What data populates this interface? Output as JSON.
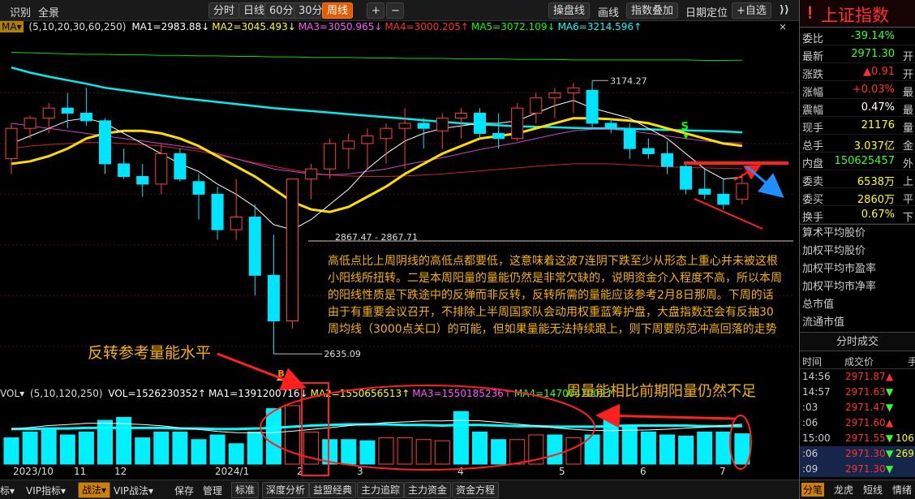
{
  "toolbar": {
    "left": [
      "识别",
      "全景"
    ],
    "periods": [
      "分时",
      "日线",
      "60分",
      "30分",
      "周线"
    ],
    "active_period": "周线",
    "plus": "+",
    "minus": "−",
    "right": [
      "操盘线",
      "画线",
      "指数叠加",
      "日期定位",
      "+自选"
    ]
  },
  "ma_row": {
    "selector": "MA▾",
    "params": "(5,10,20,30,60,250)",
    "items": [
      {
        "text": "MA1=2983.88↓",
        "color": "#ffffff"
      },
      {
        "text": "MA2=3045.493↓",
        "color": "#ffff00"
      },
      {
        "text": "MA3=3050.965↓",
        "color": "#ff55ff"
      },
      {
        "text": "MA4=3000.205↑",
        "color": "#ff3030"
      },
      {
        "text": "MA5=3072.109↓",
        "color": "#00ff00"
      },
      {
        "text": "MA6=3214.596↑",
        "color": "#00ffff"
      }
    ]
  },
  "price_labels": {
    "high": "3174.27",
    "mid": "2867.47 - 2867.71",
    "low": "2635.09"
  },
  "markers": {
    "buy": "B",
    "sell": "S"
  },
  "annotation": "高低点比上周阴线的高低点都要低，这意味着这波7连阴下跌至少从形态上重心并未被这根小阳线所扭转。二是本周阳量的量能仍然是非常欠缺的，说明资金介入程度不高，所以本周的阳线性质是下跌途中的反弹而非反转，反转所需的量能应该参考2月8日那周。下周的话由于有重要会议召开，不排除上半周国家队会动用权重蓝筹护盘，大盘指数还会有反抽30周均线（3000点关口）的可能，但如果量能无法持续跟上，则下周要防范冲高回落的走势",
  "annotation_reversal": "反转参考量能水平",
  "annotation_volume": "周量能相比前期阳量仍然不足",
  "vol_row": {
    "selector": "VOL▾",
    "params": "(5,10,120,250)",
    "items": [
      {
        "text": "VOL=1526230352↑",
        "color": "#ffffff"
      },
      {
        "text": "MA1=1391200716↓",
        "color": "#ffffff"
      },
      {
        "text": "MA2=1550656513↑",
        "color": "#ffff00"
      },
      {
        "text": "MA3=1550185236↑",
        "color": "#ff55ff"
      },
      {
        "text": "MA4=1470047002↑",
        "color": "#33ff33"
      }
    ]
  },
  "x_axis": [
    "2023/10",
    "11",
    "12",
    "2024/1",
    "2",
    "3",
    "4",
    "5",
    "6",
    "7"
  ],
  "bottom_bar": [
    "标▾",
    "VIP指标▾",
    "战法▾",
    "VIP战法▾",
    "保存",
    "管理",
    "标准",
    "深度分析",
    "益盟经典",
    "主力追踪",
    "主力资金",
    "资金方程"
  ],
  "bottom_active": "战法▾",
  "right_panel": {
    "title": "上证指数",
    "rows": [
      {
        "label": "委比",
        "value": "-39.14%",
        "color": "#33ff33",
        "suffix": ""
      },
      {
        "label": "最新",
        "value": "2971.30",
        "color": "#33ff33",
        "suffix": "开"
      },
      {
        "label": "涨跌",
        "value": "▲0.91",
        "color": "#ff3030",
        "suffix": "开"
      },
      {
        "label": "涨幅",
        "value": "+0.03%",
        "color": "#ff3030",
        "suffix": "最"
      },
      {
        "label": "震幅",
        "value": "0.47%",
        "color": "#ffffff",
        "suffix": "最"
      },
      {
        "label": "现手",
        "value": "21176",
        "color": "#ffff00",
        "suffix": "量"
      },
      {
        "label": "总手",
        "value": "3.037亿",
        "color": "#ffff00",
        "suffix": "金"
      },
      {
        "label": "内盘",
        "value": "150625457",
        "color": "#33ff33",
        "suffix": "外"
      },
      {
        "label": "委卖",
        "value": "6538万",
        "color": "#ffff00",
        "suffix": "上"
      },
      {
        "label": "委买",
        "value": "2860万",
        "color": "#ffff00",
        "suffix": "平"
      },
      {
        "label": "换手",
        "value": "0.67%",
        "color": "#ffff00",
        "suffix": "下"
      }
    ],
    "links": [
      "算术平均股价",
      "加权平均股价",
      "加权平均市盈率",
      "加权平均市净率",
      "总市值",
      "流通市值"
    ],
    "ticks_title": "分时成交",
    "ticks_header": {
      "time": "时间",
      "price": "成交价",
      "vol": "手"
    },
    "ticks": [
      {
        "time": "14:56",
        "price": "2971.87",
        "arrow": "▲",
        "color": "#ff3030",
        "vol": ""
      },
      {
        "time": "14:57",
        "price": "2971.63",
        "arrow": "▼",
        "color": "#ff3030",
        "vol": ""
      },
      {
        "time": ":03",
        "price": "2971.47",
        "arrow": "▼",
        "color": "#ff3030",
        "vol": ""
      },
      {
        "time": ":06",
        "price": "2971.60",
        "arrow": "▲",
        "color": "#ff3030",
        "vol": ""
      },
      {
        "time": "15:00",
        "price": "2971.55",
        "arrow": "▼",
        "color": "#ff3030",
        "vol": "106"
      },
      {
        "time": ":06",
        "price": "2971.30",
        "arrow": "▼",
        "color": "#ff3030",
        "vol": "269"
      },
      {
        "time": ":09",
        "price": "2971.30",
        "arrow": "▼",
        "color": "#ff3030",
        "vol": ""
      }
    ],
    "footer_tabs": [
      "分笔",
      "龙虎",
      "短线",
      "情绪"
    ]
  },
  "chart_data": {
    "type": "candlestick",
    "period": "weekly",
    "candles": [
      {
        "o": 3020,
        "h": 3090,
        "l": 2990,
        "c": 3080
      },
      {
        "o": 3080,
        "h": 3105,
        "l": 3060,
        "c": 3100
      },
      {
        "o": 3100,
        "h": 3130,
        "l": 3070,
        "c": 3120
      },
      {
        "o": 3120,
        "h": 3150,
        "l": 3080,
        "c": 3110
      },
      {
        "o": 3110,
        "h": 3160,
        "l": 3085,
        "c": 3095
      },
      {
        "o": 3095,
        "h": 3100,
        "l": 2990,
        "c": 3010
      },
      {
        "o": 3010,
        "h": 3040,
        "l": 2980,
        "c": 2985
      },
      {
        "o": 2985,
        "h": 3010,
        "l": 2945,
        "c": 2970
      },
      {
        "o": 2970,
        "h": 3050,
        "l": 2950,
        "c": 3030
      },
      {
        "o": 3030,
        "h": 3040,
        "l": 2975,
        "c": 2980
      },
      {
        "o": 2975,
        "h": 2990,
        "l": 2900,
        "c": 2950
      },
      {
        "o": 2950,
        "h": 2965,
        "l": 2860,
        "c": 2880
      },
      {
        "o": 2880,
        "h": 2980,
        "l": 2860,
        "c": 2905
      },
      {
        "o": 2905,
        "h": 2930,
        "l": 2750,
        "c": 2790
      },
      {
        "o": 2790,
        "h": 2870,
        "l": 2635,
        "c": 2700
      },
      {
        "o": 2700,
        "h": 2960,
        "l": 2685,
        "c": 2980
      },
      {
        "o": 2980,
        "h": 3010,
        "l": 2940,
        "c": 3000
      },
      {
        "o": 3000,
        "h": 3060,
        "l": 2980,
        "c": 3050
      },
      {
        "o": 3040,
        "h": 3070,
        "l": 3000,
        "c": 3055
      },
      {
        "o": 3050,
        "h": 3080,
        "l": 3000,
        "c": 3065
      },
      {
        "o": 3060,
        "h": 3090,
        "l": 3010,
        "c": 3080
      },
      {
        "o": 3080,
        "h": 3120,
        "l": 3000,
        "c": 3090
      },
      {
        "o": 3090,
        "h": 3100,
        "l": 3040,
        "c": 3080
      },
      {
        "o": 3075,
        "h": 3110,
        "l": 3040,
        "c": 3100
      },
      {
        "o": 3100,
        "h": 3120,
        "l": 3060,
        "c": 3110
      },
      {
        "o": 3110,
        "h": 3120,
        "l": 3060,
        "c": 3070
      },
      {
        "o": 3070,
        "h": 3110,
        "l": 3040,
        "c": 3060
      },
      {
        "o": 3060,
        "h": 3130,
        "l": 3055,
        "c": 3120
      },
      {
        "o": 3110,
        "h": 3150,
        "l": 3090,
        "c": 3140
      },
      {
        "o": 3140,
        "h": 3160,
        "l": 3100,
        "c": 3150
      },
      {
        "o": 3150,
        "h": 3170,
        "l": 3110,
        "c": 3160
      },
      {
        "o": 3155,
        "h": 3174.27,
        "l": 3080,
        "c": 3090
      },
      {
        "o": 3090,
        "h": 3100,
        "l": 3070,
        "c": 3080
      },
      {
        "o": 3080,
        "h": 3090,
        "l": 3020,
        "c": 3040
      },
      {
        "o": 3040,
        "h": 3060,
        "l": 3020,
        "c": 3030
      },
      {
        "o": 3030,
        "h": 3055,
        "l": 2990,
        "c": 3005
      },
      {
        "o": 3005,
        "h": 3010,
        "l": 2950,
        "c": 2960
      },
      {
        "o": 2960,
        "h": 3000,
        "l": 2940,
        "c": 2950
      },
      {
        "o": 2950,
        "h": 2980,
        "l": 2920,
        "c": 2930
      },
      {
        "o": 2940,
        "h": 2990,
        "l": 2930,
        "c": 2971.3
      }
    ],
    "ma5": [
      3050,
      3065,
      3080,
      3095,
      3100,
      3090,
      3070,
      3050,
      3030,
      3010,
      2995,
      2970,
      2950,
      2925,
      2890,
      2880,
      2900,
      2930,
      2960,
      3000,
      3030,
      3055,
      3070,
      3080,
      3085,
      3090,
      3090,
      3095,
      3110,
      3125,
      3135,
      3120,
      3110,
      3100,
      3080,
      3060,
      3030,
      3000,
      2980,
      2983.88
    ],
    "ma10": [
      3010,
      3015,
      3025,
      3040,
      3060,
      3070,
      3075,
      3075,
      3070,
      3060,
      3045,
      3025,
      3005,
      2985,
      2960,
      2935,
      2920,
      2915,
      2925,
      2945,
      2965,
      2990,
      3010,
      3030,
      3045,
      3060,
      3065,
      3070,
      3080,
      3090,
      3100,
      3100,
      3098,
      3095,
      3090,
      3080,
      3070,
      3060,
      3050,
      3045.49
    ],
    "ma20": [
      3090,
      3085,
      3080,
      3075,
      3070,
      3065,
      3060,
      3055,
      3050,
      3045,
      3040,
      3030,
      3020,
      3010,
      3000,
      2995,
      2990,
      2988,
      2990,
      2995,
      3000,
      3008,
      3015,
      3022,
      3030,
      3038,
      3045,
      3052,
      3060,
      3068,
      3075,
      3078,
      3078,
      3075,
      3070,
      3065,
      3060,
      3055,
      3052,
      3050.97
    ],
    "ma30": [
      3040,
      3045,
      3048,
      3050,
      3052,
      3052,
      3050,
      3048,
      3045,
      3040,
      3035,
      3028,
      3020,
      3012,
      3005,
      2998,
      2992,
      2988,
      2986,
      2985,
      2985,
      2986,
      2988,
      2990,
      2993,
      2996,
      2999,
      3002,
      3005,
      3008,
      3010,
      3010,
      3010,
      3008,
      3006,
      3004,
      3003,
      3002,
      3001,
      3000.21
    ],
    "ma60": [
      3200,
      3190,
      3182,
      3175,
      3168,
      3160,
      3155,
      3150,
      3145,
      3140,
      3136,
      3132,
      3128,
      3124,
      3120,
      3117,
      3114,
      3111,
      3108,
      3105,
      3102,
      3099,
      3096,
      3093,
      3090,
      3088,
      3086,
      3084,
      3083,
      3082,
      3081,
      3080,
      3080,
      3079,
      3078,
      3077,
      3076,
      3075,
      3074,
      3072.11
    ],
    "ma250": [
      3230,
      3229,
      3228,
      3227,
      3226,
      3226,
      3225,
      3225,
      3224,
      3224,
      3223,
      3223,
      3222,
      3222,
      3221,
      3221,
      3220,
      3220,
      3220,
      3219,
      3219,
      3218,
      3218,
      3218,
      3217,
      3217,
      3217,
      3216,
      3216,
      3216,
      3215,
      3215,
      3215,
      3215,
      3215,
      3215,
      3215,
      3214,
      3214,
      3214.6
    ],
    "volume_ratio": [
      0.45,
      0.55,
      0.6,
      0.5,
      0.55,
      0.75,
      0.8,
      0.45,
      0.55,
      0.55,
      0.42,
      0.5,
      0.35,
      0.55,
      0.95,
      1.0,
      0.55,
      0.42,
      0.42,
      0.4,
      0.45,
      0.45,
      0.42,
      0.4,
      0.9,
      0.55,
      0.42,
      0.42,
      0.5,
      0.5,
      0.45,
      0.5,
      0.8,
      0.65,
      0.55,
      0.5,
      0.48,
      0.55,
      0.55,
      0.52
    ],
    "vol_ma": [
      0.6,
      0.6,
      0.61,
      0.61,
      0.62,
      0.62,
      0.62,
      0.62,
      0.62,
      0.61,
      0.61,
      0.6,
      0.6,
      0.61,
      0.62,
      0.64,
      0.66,
      0.67,
      0.68,
      0.68,
      0.68,
      0.67,
      0.67,
      0.66,
      0.67,
      0.67,
      0.66,
      0.65,
      0.65,
      0.64,
      0.64,
      0.64,
      0.65,
      0.66,
      0.66,
      0.66,
      0.66,
      0.65,
      0.65,
      0.65
    ],
    "ylim": [
      2600,
      3250
    ]
  }
}
